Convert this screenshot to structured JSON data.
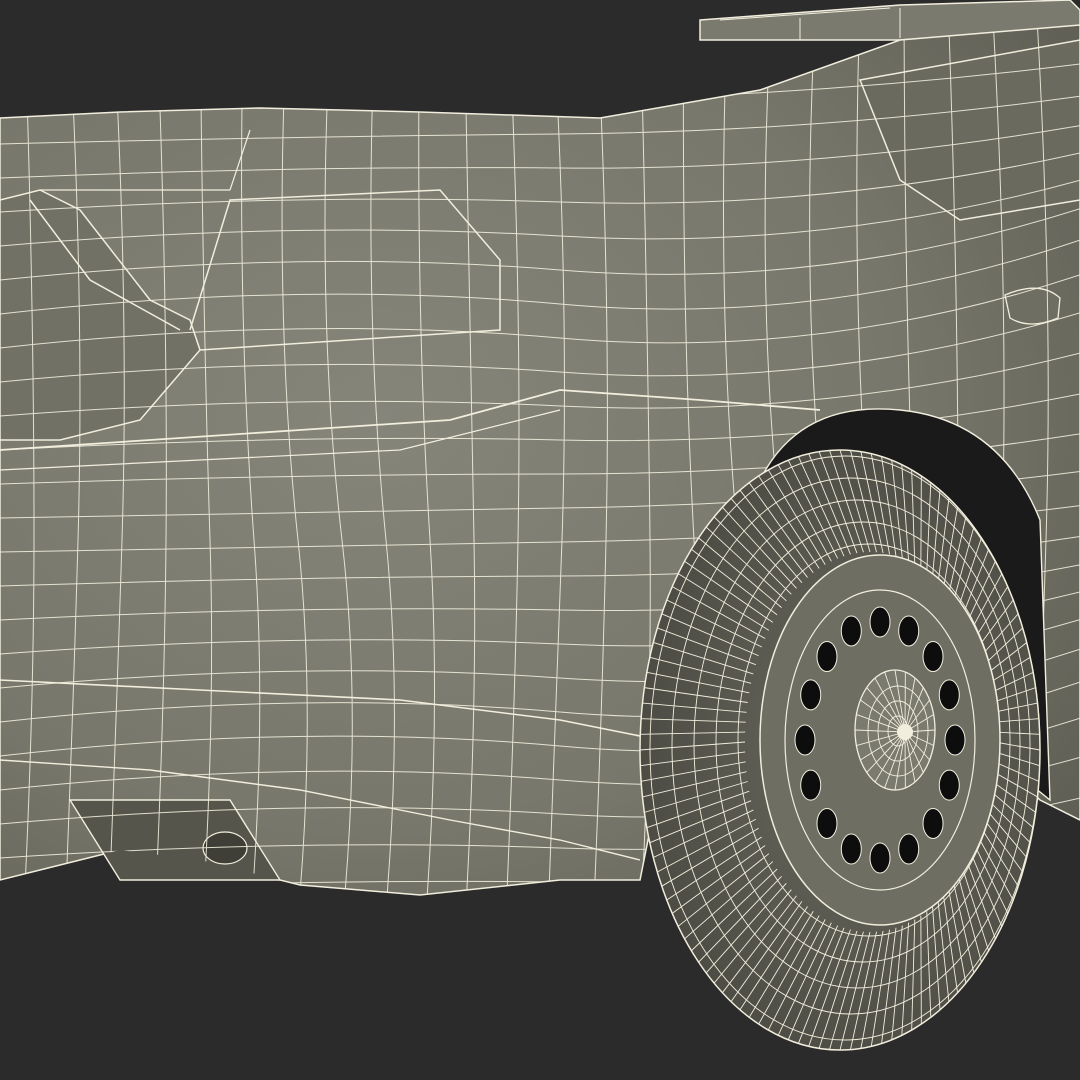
{
  "scene": {
    "subject": "car-rear-wireframe",
    "colors": {
      "background": "#2b2b2b",
      "body_fill": "#7d7d70",
      "body_shade": "#6c6c60",
      "body_dark": "#55554b",
      "wire": "#f2eedd",
      "wheel_well": "#1a1a1a",
      "tire": "#5f5f55",
      "rim": "#6e6e63",
      "hole": "#0d0d0d"
    }
  }
}
